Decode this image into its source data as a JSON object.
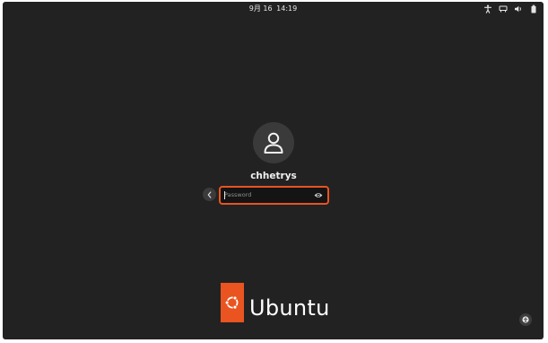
{
  "topbar": {
    "date": "9月 16",
    "time": "14:19",
    "tray_icons": [
      "accessibility-icon",
      "network-icon",
      "volume-icon",
      "battery-icon"
    ]
  },
  "login": {
    "username": "chhetrys",
    "avatar_icon": "user-avatar-icon",
    "password": {
      "placeholder": "Password",
      "value": ""
    },
    "back_icon": "chevron-left-icon",
    "reveal_icon": "eye-icon"
  },
  "branding": {
    "logo_text": "Ubuntu",
    "accent_color": "#E95420"
  },
  "bottom_right_icon": "accessibility-menu-icon",
  "colors": {
    "background": "#222222",
    "focus_border": "#E95420"
  }
}
